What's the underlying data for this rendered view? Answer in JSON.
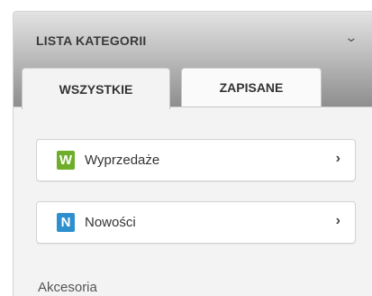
{
  "header": {
    "title": "LISTA KATEGORII",
    "toggle_icon": "chevron-down-icon",
    "toggle_glyph": "⌄"
  },
  "tabs": [
    {
      "label": "WSZYSTKIE",
      "active": true
    },
    {
      "label": "ZAPISANE",
      "active": false
    }
  ],
  "items": [
    {
      "label": "Wyprzedaże",
      "icon_letter": "W",
      "icon_color": "#6fae2a",
      "chevron": "›"
    },
    {
      "label": "Nowości",
      "icon_letter": "N",
      "icon_color": "#2e8fcf",
      "chevron": "›"
    }
  ],
  "plain_items": [
    {
      "label": "Akcesoria"
    }
  ]
}
